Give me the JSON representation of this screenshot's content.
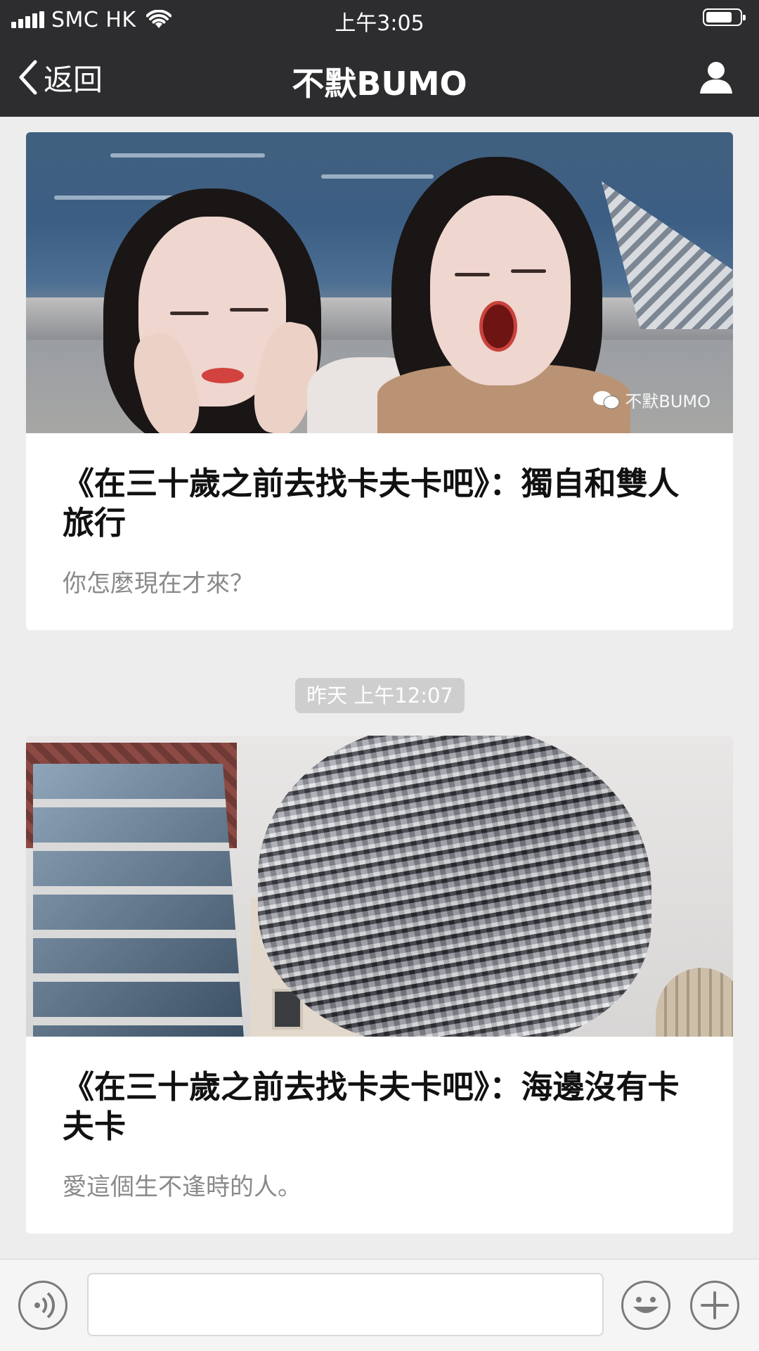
{
  "status_bar": {
    "carrier": "SMC HK",
    "time": "上午3:05",
    "battery_level": 0.75
  },
  "nav": {
    "back_label": "返回",
    "title": "不默BUMO",
    "icons": {
      "back": "chevron-left-icon",
      "profile": "person-icon"
    }
  },
  "feed": {
    "cards": [
      {
        "title": "《在三十歲之前去找卡夫卡吧》：獨自和雙人旅行",
        "description": "你怎麼現在才來？",
        "watermark": "不默BUMO"
      },
      {
        "title": "《在三十歲之前去找卡夫卡吧》：海邊沒有卡夫卡",
        "description": "愛這個生不逢時的人。"
      }
    ],
    "timestamp": "昨天 上午12:07"
  },
  "input_bar": {
    "icons": {
      "voice": "voice-icon",
      "emoji": "emoji-icon",
      "more": "plus-icon"
    },
    "text_value": ""
  },
  "colors": {
    "bar_background": "#2d2d30",
    "page_background": "#ededed",
    "timestamp_chip": "#cecece"
  }
}
